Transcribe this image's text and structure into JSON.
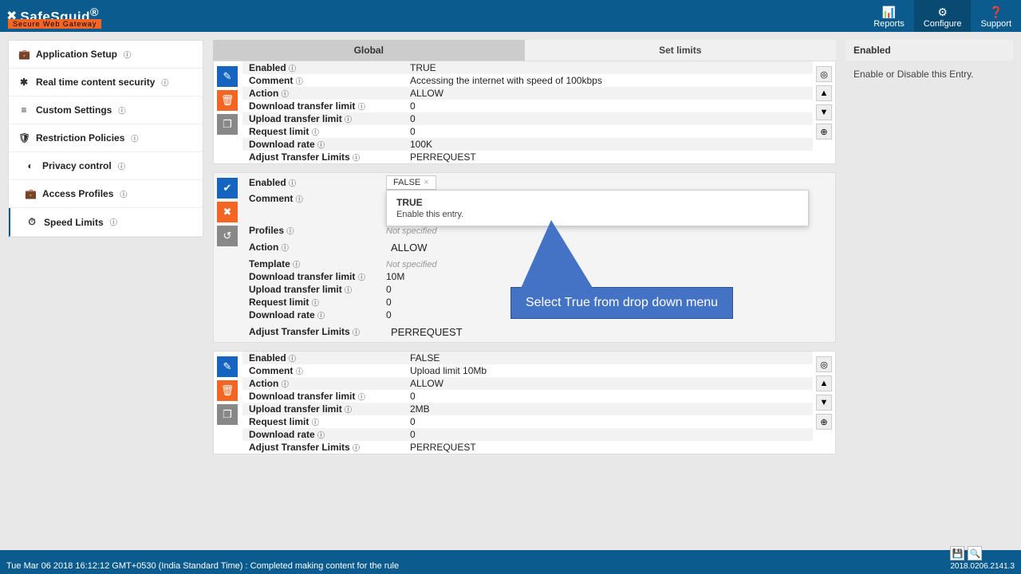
{
  "header": {
    "brand": "SafeSquid",
    "reg": "®",
    "tagline": "Secure Web Gateway",
    "nav": {
      "reports": "Reports",
      "configure": "Configure",
      "support": "Support"
    }
  },
  "sidebar": {
    "items": [
      {
        "icon": "💼",
        "label": "Application Setup"
      },
      {
        "icon": "✱",
        "label": "Real time content security"
      },
      {
        "icon": "≡",
        "label": "Custom Settings"
      },
      {
        "icon": "🛡",
        "label": "Restriction Policies"
      },
      {
        "icon": "◐",
        "label": "Privacy control"
      },
      {
        "icon": "💼",
        "label": "Access Profiles"
      },
      {
        "icon": "⏱",
        "label": "Speed Limits"
      }
    ]
  },
  "tabs": {
    "global": "Global",
    "setlimits": "Set limits"
  },
  "entry1": {
    "enabled_l": "Enabled",
    "enabled_v": "TRUE",
    "comment_l": "Comment",
    "comment_v": "Accessing the internet with speed of 100kbps",
    "action_l": "Action",
    "action_v": "ALLOW",
    "dtl_l": "Download transfer limit",
    "dtl_v": "0",
    "utl_l": "Upload transfer limit",
    "utl_v": "0",
    "req_l": "Request limit",
    "req_v": "0",
    "rate_l": "Download rate",
    "rate_v": "100K",
    "adj_l": "Adjust Transfer Limits",
    "adj_v": "PERREQUEST"
  },
  "entry2": {
    "enabled_l": "Enabled",
    "enabled_tag": "FALSE",
    "comment_l": "Comment",
    "profiles_l": "Profiles",
    "profiles_ph": "Not specified",
    "action_l": "Action",
    "action_v": "ALLOW",
    "template_l": "Template",
    "template_ph": "Not specified",
    "dtl_l": "Download transfer limit",
    "dtl_v": "10M",
    "utl_l": "Upload transfer limit",
    "utl_v": "0",
    "req_l": "Request limit",
    "req_v": "0",
    "rate_l": "Download rate",
    "rate_v": "0",
    "adj_l": "Adjust Transfer Limits",
    "adj_v": "PERREQUEST",
    "dropdown": {
      "title": "TRUE",
      "desc": "Enable this entry."
    }
  },
  "entry3": {
    "enabled_l": "Enabled",
    "enabled_v": "FALSE",
    "comment_l": "Comment",
    "comment_v": "Upload limit 10Mb",
    "action_l": "Action",
    "action_v": "ALLOW",
    "dtl_l": "Download transfer limit",
    "dtl_v": "0",
    "utl_l": "Upload transfer limit",
    "utl_v": "2MB",
    "req_l": "Request limit",
    "req_v": "0",
    "rate_l": "Download rate",
    "rate_v": "0",
    "adj_l": "Adjust Transfer Limits",
    "adj_v": "PERREQUEST"
  },
  "help": {
    "title": "Enabled",
    "desc": "Enable or Disable this Entry."
  },
  "callout": "Select True from drop down menu",
  "footer": {
    "status": "Tue Mar 06 2018 16:12:12 GMT+0530 (India Standard Time) : Completed making content for the rule",
    "version": "2018.0206.2141.3"
  }
}
